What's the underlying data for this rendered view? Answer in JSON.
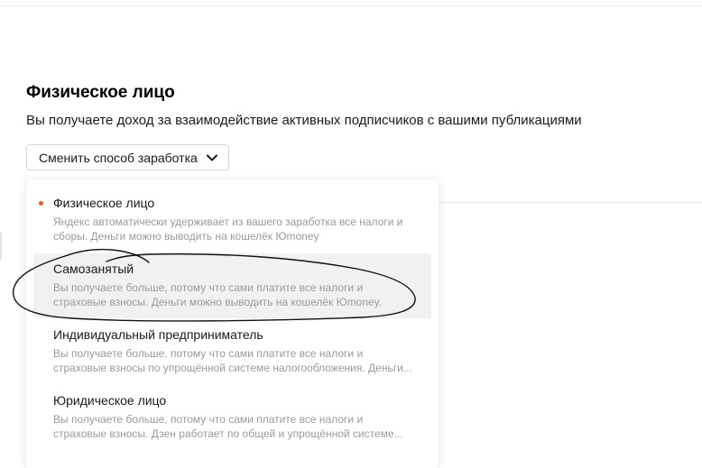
{
  "colors": {
    "selected_dot": "#f4582a",
    "scribble": "#111111"
  },
  "header": {
    "title": "Физическое лицо",
    "description": "Вы получаете доход за взаимодействие активных подписчиков с вашими публикациями"
  },
  "switch_button": {
    "label": "Сменить способ заработка",
    "icon": "chevron-down-icon"
  },
  "dropdown": {
    "options": [
      {
        "title": "Физическое лицо",
        "desc_line1": "Яндекс автоматически удерживает из вашего заработка все налоги и",
        "desc_line2": "сборы. Деньги можно выводить на кошелёк Юmoney",
        "selected": true
      },
      {
        "title": "Самозанятый",
        "desc_line1": "Вы получаете больше, потому что сами платите все налоги и",
        "desc_line2": "страховые взносы. Деньги можно выводить на кошелёк Юmoney.",
        "selected": false
      },
      {
        "title": "Индивидуальный предприниматель",
        "desc_line1": "Вы получаете больше, потому что сами платите все налоги и",
        "desc_line2": "страховые взносы по упрощённой системе налогообложения. Деньги...",
        "selected": false
      },
      {
        "title": "Юридическое лицо",
        "desc_line1": "Вы получаете больше, потому что сами платите все налоги и",
        "desc_line2": "страховые взносы. Дзен работает по общей и упрощённой системе...",
        "selected": false
      }
    ]
  }
}
